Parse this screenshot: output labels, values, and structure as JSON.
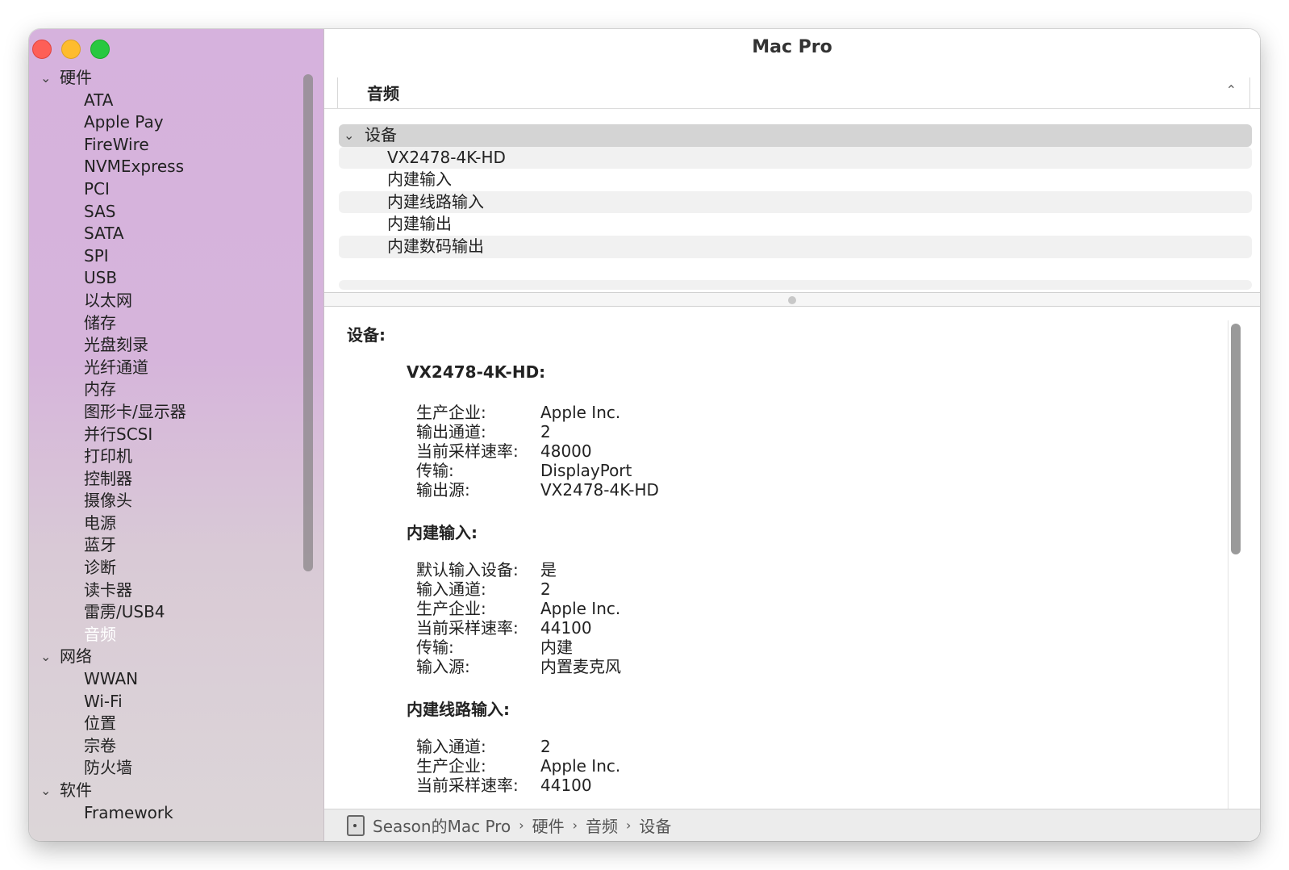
{
  "window": {
    "title": "Mac Pro"
  },
  "sidebar": {
    "groups": [
      {
        "label": "硬件",
        "items": [
          "ATA",
          "Apple Pay",
          "FireWire",
          "NVMExpress",
          "PCI",
          "SAS",
          "SATA",
          "SPI",
          "USB",
          "以太网",
          "储存",
          "光盘刻录",
          "光纤通道",
          "内存",
          "图形卡/显示器",
          "并行SCSI",
          "打印机",
          "控制器",
          "摄像头",
          "电源",
          "蓝牙",
          "诊断",
          "读卡器",
          "雷雳/USB4",
          "音频"
        ]
      },
      {
        "label": "网络",
        "items": [
          "WWAN",
          "Wi-Fi",
          "位置",
          "宗卷",
          "防火墙"
        ]
      },
      {
        "label": "软件",
        "items": [
          "Framework"
        ]
      }
    ],
    "selected": "音频"
  },
  "section": {
    "label": "音频"
  },
  "device_list": {
    "header": "设备",
    "items": [
      "VX2478-4K-HD",
      "内建输入",
      "内建线路输入",
      "内建输出",
      "内建数码输出"
    ]
  },
  "detail": {
    "title": "设备:",
    "devices": [
      {
        "name": "VX2478-4K-HD:",
        "props": [
          [
            "生产企业:",
            "Apple Inc."
          ],
          [
            "输出通道:",
            "2"
          ],
          [
            "当前采样速率:",
            "48000"
          ],
          [
            "传输:",
            "DisplayPort"
          ],
          [
            "输出源:",
            "VX2478-4K-HD"
          ]
        ]
      },
      {
        "name": "内建输入:",
        "props": [
          [
            "默认输入设备:",
            "是"
          ],
          [
            "输入通道:",
            "2"
          ],
          [
            "生产企业:",
            "Apple Inc."
          ],
          [
            "当前采样速率:",
            "44100"
          ],
          [
            "传输:",
            "内建"
          ],
          [
            "输入源:",
            "内置麦克风"
          ]
        ]
      },
      {
        "name": "内建线路输入:",
        "props": [
          [
            "输入通道:",
            "2"
          ],
          [
            "生产企业:",
            "Apple Inc."
          ],
          [
            "当前采样速率:",
            "44100"
          ]
        ]
      }
    ]
  },
  "pathbar": {
    "items": [
      "Season的Mac Pro",
      "硬件",
      "音频",
      "设备"
    ]
  },
  "colors": {
    "selection": "#4a87f0",
    "sidebar_tint": "#d6b2dd"
  }
}
